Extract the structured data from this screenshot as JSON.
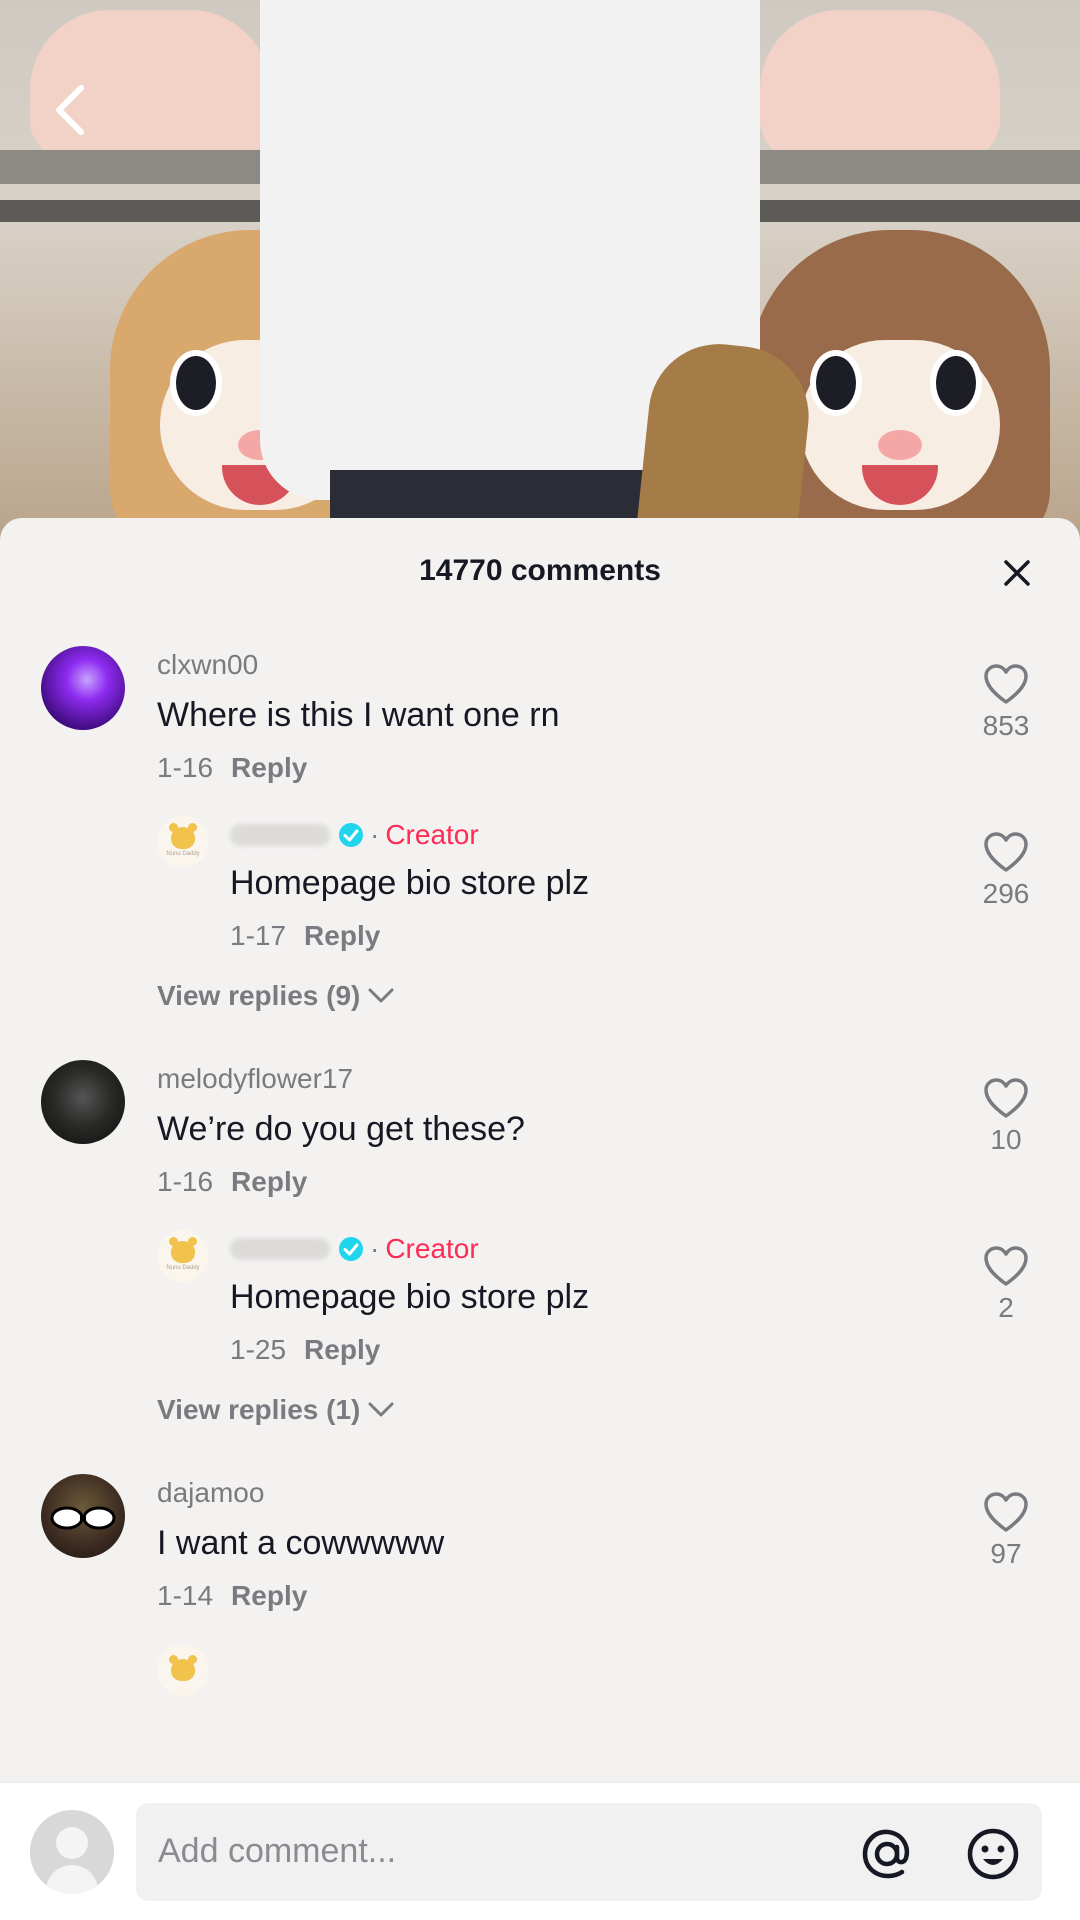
{
  "header": {
    "comments_count_label": "14770 comments"
  },
  "comments": [
    {
      "username": "clxwn00",
      "text": "Where is this I want one rn",
      "date": "1-16",
      "reply_label": "Reply",
      "likes": "853",
      "creator_reply": {
        "creator_label": "Creator",
        "text": "Homepage bio store plz",
        "date": "1-17",
        "reply_label": "Reply",
        "likes": "296",
        "avatar_brand": "Nunu Daddy"
      },
      "view_replies": "View replies (9)"
    },
    {
      "username": "melodyflower17",
      "text": "We’re do you get these?",
      "date": "1-16",
      "reply_label": "Reply",
      "likes": "10",
      "creator_reply": {
        "creator_label": "Creator",
        "text": "Homepage bio store plz",
        "date": "1-25",
        "reply_label": "Reply",
        "likes": "2",
        "avatar_brand": "Nunu Daddy"
      },
      "view_replies": "View replies (1)"
    },
    {
      "username": "dajamoo",
      "text": "I want a cowwwww",
      "date": "1-14",
      "reply_label": "Reply",
      "likes": "97"
    }
  ],
  "input": {
    "placeholder": "Add comment..."
  },
  "colors": {
    "creator": "#fe2c55",
    "verified": "#20d5ec",
    "secondary_text": "#7a7b80",
    "primary_text": "#161823"
  },
  "icons": [
    "back-arrow-icon",
    "close-icon",
    "heart-icon",
    "verified-icon",
    "chevron-down-icon",
    "at-icon",
    "emoji-icon"
  ]
}
